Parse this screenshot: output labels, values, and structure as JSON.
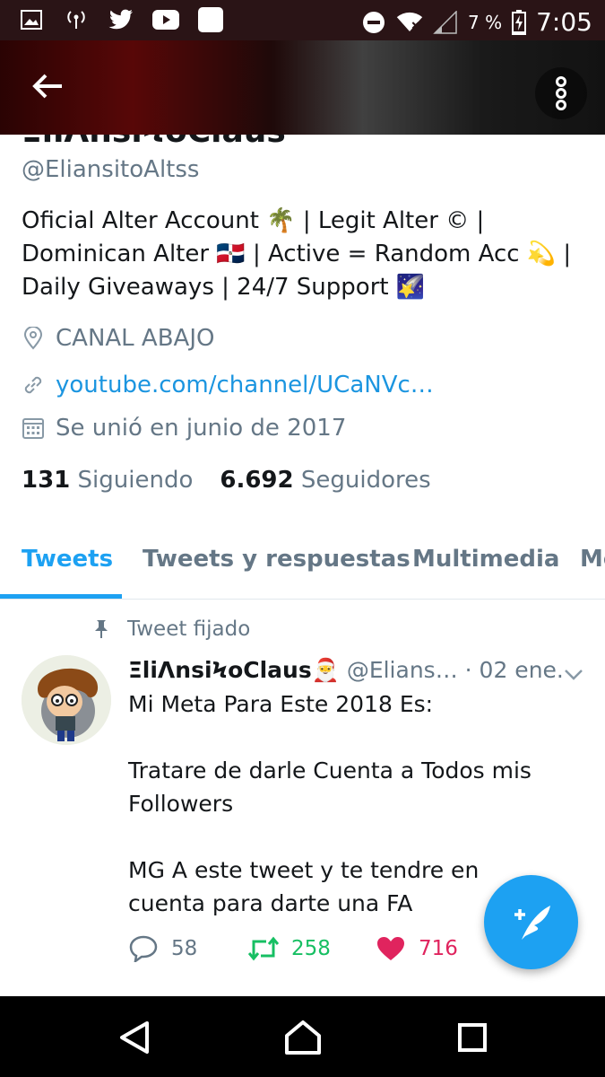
{
  "status_bar": {
    "battery": "7 %",
    "time": "7:05"
  },
  "header": {
    "partial_name": "ΞliΛnsiϞoClaus"
  },
  "profile": {
    "handle": "@EliansitoAltss",
    "bio_lines": [
      "Oficial Alter Account 🌴 | Legit Alter © |",
      "Dominican Alter 🇩🇴  | Active = Random Acc 💫 |",
      "Daily Giveaways | 24/7 Support 🌠"
    ],
    "location": "CANAL ABAJO",
    "website": "youtube.com/channel/UCaNVc…",
    "joined": "Se unió en junio de 2017",
    "following_count": "131",
    "following_label": "Siguiendo",
    "followers_count": "6.692",
    "followers_label": "Seguidores"
  },
  "tabs": [
    {
      "label": "Tweets",
      "active": true
    },
    {
      "label": "Tweets y respuestas",
      "active": false
    },
    {
      "label": "Multimedia",
      "active": false
    },
    {
      "label": "Me",
      "active": false
    }
  ],
  "tweet": {
    "pinned_label": "Tweet fijado",
    "author_name": "ΞliΛnsiϞoClaus🎅",
    "author_handle": "@Elians…",
    "date": "· 02 ene.",
    "text": "Mi Meta Para Este 2018 Es:\n\nTratare de darle Cuenta a Todos mis Followers\n\nMG A este tweet y te tendre en cuenta para darte una FA",
    "replies": "58",
    "retweets": "258",
    "likes": "716"
  },
  "colors": {
    "accent": "#1da1f2",
    "link": "#1b95e0",
    "muted": "#657786",
    "retweet": "#17bf63",
    "like": "#e0245e"
  },
  "icons": [
    "gallery-icon",
    "broadcast-icon",
    "twitter-bird-icon",
    "youtube-icon",
    "notification-square-icon",
    "do-not-disturb-icon",
    "wifi-icon",
    "signal-icon",
    "battery-charging-icon",
    "back-arrow-icon",
    "more-vertical-icon",
    "location-pin-icon",
    "link-icon",
    "calendar-icon",
    "pin-icon",
    "chevron-down-icon",
    "reply-icon",
    "retweet-icon",
    "heart-icon",
    "compose-feather-icon",
    "nav-back-icon",
    "nav-home-icon",
    "nav-recents-icon"
  ]
}
